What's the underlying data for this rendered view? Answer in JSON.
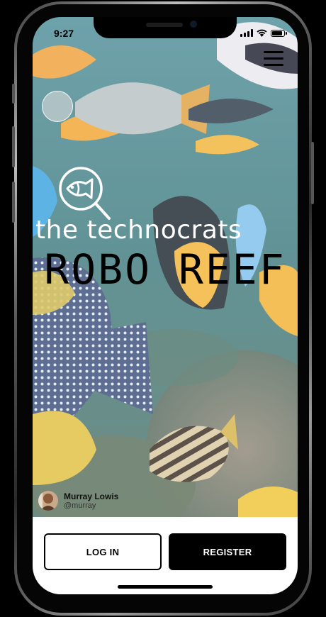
{
  "status_bar": {
    "time": "9:27"
  },
  "brand": {
    "name": "the technocrats"
  },
  "app": {
    "title": "ROBO REEF"
  },
  "attribution": {
    "name": "Murray Lowis",
    "handle": "@murray"
  },
  "actions": {
    "login_label": "LOG IN",
    "register_label": "REGISTER"
  },
  "icons": {
    "menu": "hamburger-menu-icon",
    "logo": "fish-magnifier-icon",
    "signal": "cellular-signal-icon",
    "wifi": "wifi-icon",
    "battery": "battery-icon"
  },
  "colors": {
    "primary": "#000000",
    "panel": "#ffffff",
    "brand_text": "#ffffff"
  }
}
